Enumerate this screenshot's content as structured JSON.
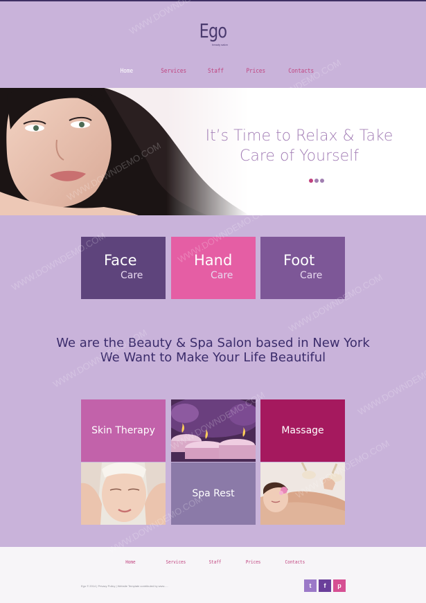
{
  "header": {
    "logo": "Ego",
    "tagline": "beauty salon"
  },
  "nav": [
    {
      "label": "Home",
      "active": true
    },
    {
      "label": "Services"
    },
    {
      "label": "Staff"
    },
    {
      "label": "Prices"
    },
    {
      "label": "Contacts"
    }
  ],
  "hero": {
    "title_line1": "It’s Time to Relax & Take",
    "title_line2": "Care of Yourself"
  },
  "care_tiles": [
    {
      "title": "Face",
      "subtitle": "Care",
      "color": "#5e447c"
    },
    {
      "title": "Hand",
      "subtitle": "Care",
      "color": "#e55ea4"
    },
    {
      "title": "Foot",
      "subtitle": "Care",
      "color": "#7d5797"
    }
  ],
  "intro": {
    "line1": "We are the Beauty & Spa Salon based in New York",
    "line2": "We Want to Make Your Life Beautiful"
  },
  "gallery": {
    "skin_therapy": "Skin Therapy",
    "massage": "Massage",
    "spa_rest": "Spa Rest"
  },
  "footer": {
    "nav": [
      "Home",
      "Services",
      "Staff",
      "Prices",
      "Contacts"
    ],
    "copyright": "Ego © 2014 | Privacy Policy | Website Template contributed by www.....",
    "social": [
      "t",
      "f",
      "p"
    ]
  },
  "watermark": "WWW.DOWNDEMO.COM",
  "colors": {
    "background": "#c9b3da",
    "accent_pink": "#c0427e",
    "deep_purple": "#3b2c6b",
    "twitter": "#9b79c8",
    "facebook": "#6a3f9a",
    "pinterest": "#d64f93"
  }
}
